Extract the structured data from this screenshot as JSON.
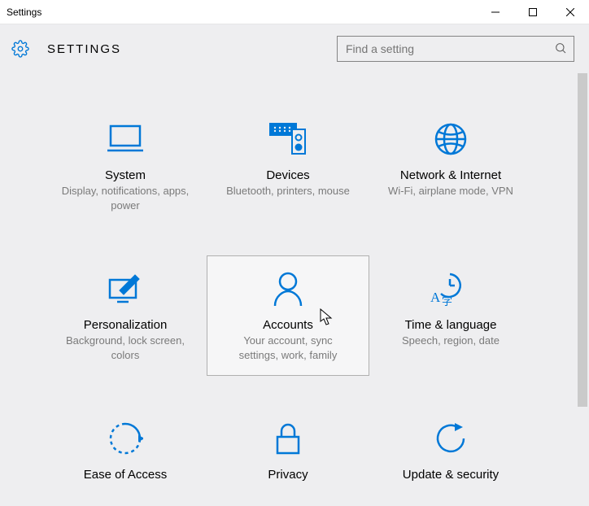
{
  "window": {
    "title": "Settings"
  },
  "header": {
    "title": "SETTINGS"
  },
  "search": {
    "placeholder": "Find a setting"
  },
  "tiles": [
    {
      "title": "System",
      "sub": "Display, notifications, apps, power"
    },
    {
      "title": "Devices",
      "sub": "Bluetooth, printers, mouse"
    },
    {
      "title": "Network & Internet",
      "sub": "Wi-Fi, airplane mode, VPN"
    },
    {
      "title": "Personalization",
      "sub": "Background, lock screen, colors"
    },
    {
      "title": "Accounts",
      "sub": "Your account, sync settings, work, family"
    },
    {
      "title": "Time & language",
      "sub": "Speech, region, date"
    },
    {
      "title": "Ease of Access",
      "sub": ""
    },
    {
      "title": "Privacy",
      "sub": ""
    },
    {
      "title": "Update & security",
      "sub": ""
    }
  ]
}
